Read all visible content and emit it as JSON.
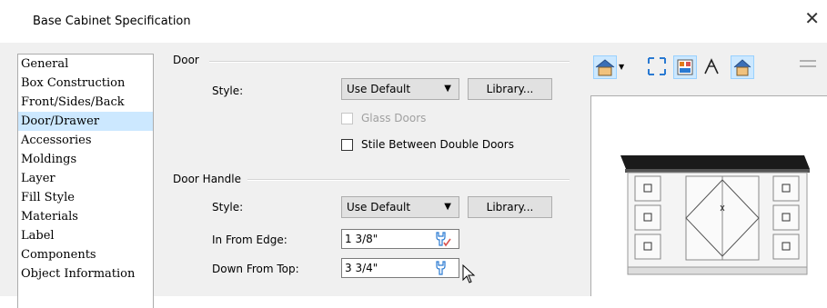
{
  "window": {
    "title": "Base Cabinet Specification",
    "close_glyph": "✕"
  },
  "nav": {
    "items": [
      "General",
      "Box Construction",
      "Front/Sides/Back",
      "Door/Drawer",
      "Accessories",
      "Moldings",
      "Layer",
      "Fill Style",
      "Materials",
      "Label",
      "Components",
      "Object Information"
    ],
    "selected": "Door/Drawer"
  },
  "door": {
    "section_label": "Door",
    "style_label": "Style:",
    "style_value": "Use Default",
    "library_label": "Library...",
    "glass_doors_label": "Glass Doors",
    "glass_doors_checked": false,
    "glass_doors_enabled": false,
    "stile_label": "Stile Between Double Doors",
    "stile_checked": false
  },
  "door_handle": {
    "section_label": "Door Handle",
    "style_label": "Style:",
    "style_value": "Use Default",
    "library_label": "Library...",
    "in_from_edge_label": "In From Edge:",
    "in_from_edge_value": "1 3/8\"",
    "down_from_top_label": "Down From Top:",
    "down_from_top_value": "3 3/4\""
  },
  "toolbar": {
    "icons": [
      "view-angle-icon",
      "fill-window-icon",
      "render-options-icon",
      "orbit-icon",
      "camera-view-icon",
      "dimension-icon"
    ]
  },
  "colors": {
    "accent": "#cce8ff",
    "panel_bg": "#f0f0f0",
    "button_bg": "#e1e1e1",
    "wrench_red": "#d9534f",
    "icon_blue": "#2a7ad2",
    "icon_orange": "#e07b1a"
  }
}
